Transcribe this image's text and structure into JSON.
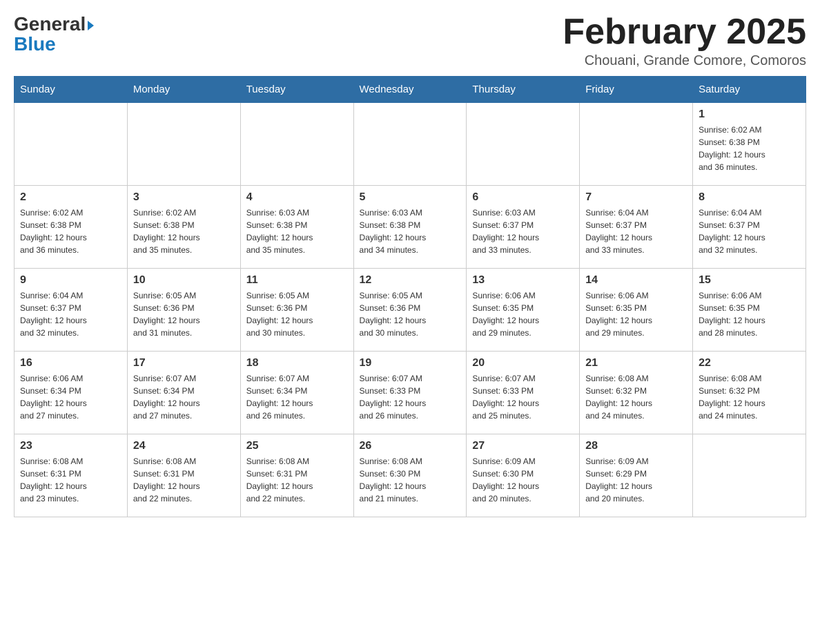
{
  "header": {
    "logo_line1": "General",
    "logo_line2": "Blue",
    "month_title": "February 2025",
    "location": "Chouani, Grande Comore, Comoros"
  },
  "days_of_week": [
    "Sunday",
    "Monday",
    "Tuesday",
    "Wednesday",
    "Thursday",
    "Friday",
    "Saturday"
  ],
  "weeks": [
    [
      {
        "day": "",
        "info": ""
      },
      {
        "day": "",
        "info": ""
      },
      {
        "day": "",
        "info": ""
      },
      {
        "day": "",
        "info": ""
      },
      {
        "day": "",
        "info": ""
      },
      {
        "day": "",
        "info": ""
      },
      {
        "day": "1",
        "info": "Sunrise: 6:02 AM\nSunset: 6:38 PM\nDaylight: 12 hours\nand 36 minutes."
      }
    ],
    [
      {
        "day": "2",
        "info": "Sunrise: 6:02 AM\nSunset: 6:38 PM\nDaylight: 12 hours\nand 36 minutes."
      },
      {
        "day": "3",
        "info": "Sunrise: 6:02 AM\nSunset: 6:38 PM\nDaylight: 12 hours\nand 35 minutes."
      },
      {
        "day": "4",
        "info": "Sunrise: 6:03 AM\nSunset: 6:38 PM\nDaylight: 12 hours\nand 35 minutes."
      },
      {
        "day": "5",
        "info": "Sunrise: 6:03 AM\nSunset: 6:38 PM\nDaylight: 12 hours\nand 34 minutes."
      },
      {
        "day": "6",
        "info": "Sunrise: 6:03 AM\nSunset: 6:37 PM\nDaylight: 12 hours\nand 33 minutes."
      },
      {
        "day": "7",
        "info": "Sunrise: 6:04 AM\nSunset: 6:37 PM\nDaylight: 12 hours\nand 33 minutes."
      },
      {
        "day": "8",
        "info": "Sunrise: 6:04 AM\nSunset: 6:37 PM\nDaylight: 12 hours\nand 32 minutes."
      }
    ],
    [
      {
        "day": "9",
        "info": "Sunrise: 6:04 AM\nSunset: 6:37 PM\nDaylight: 12 hours\nand 32 minutes."
      },
      {
        "day": "10",
        "info": "Sunrise: 6:05 AM\nSunset: 6:36 PM\nDaylight: 12 hours\nand 31 minutes."
      },
      {
        "day": "11",
        "info": "Sunrise: 6:05 AM\nSunset: 6:36 PM\nDaylight: 12 hours\nand 30 minutes."
      },
      {
        "day": "12",
        "info": "Sunrise: 6:05 AM\nSunset: 6:36 PM\nDaylight: 12 hours\nand 30 minutes."
      },
      {
        "day": "13",
        "info": "Sunrise: 6:06 AM\nSunset: 6:35 PM\nDaylight: 12 hours\nand 29 minutes."
      },
      {
        "day": "14",
        "info": "Sunrise: 6:06 AM\nSunset: 6:35 PM\nDaylight: 12 hours\nand 29 minutes."
      },
      {
        "day": "15",
        "info": "Sunrise: 6:06 AM\nSunset: 6:35 PM\nDaylight: 12 hours\nand 28 minutes."
      }
    ],
    [
      {
        "day": "16",
        "info": "Sunrise: 6:06 AM\nSunset: 6:34 PM\nDaylight: 12 hours\nand 27 minutes."
      },
      {
        "day": "17",
        "info": "Sunrise: 6:07 AM\nSunset: 6:34 PM\nDaylight: 12 hours\nand 27 minutes."
      },
      {
        "day": "18",
        "info": "Sunrise: 6:07 AM\nSunset: 6:34 PM\nDaylight: 12 hours\nand 26 minutes."
      },
      {
        "day": "19",
        "info": "Sunrise: 6:07 AM\nSunset: 6:33 PM\nDaylight: 12 hours\nand 26 minutes."
      },
      {
        "day": "20",
        "info": "Sunrise: 6:07 AM\nSunset: 6:33 PM\nDaylight: 12 hours\nand 25 minutes."
      },
      {
        "day": "21",
        "info": "Sunrise: 6:08 AM\nSunset: 6:32 PM\nDaylight: 12 hours\nand 24 minutes."
      },
      {
        "day": "22",
        "info": "Sunrise: 6:08 AM\nSunset: 6:32 PM\nDaylight: 12 hours\nand 24 minutes."
      }
    ],
    [
      {
        "day": "23",
        "info": "Sunrise: 6:08 AM\nSunset: 6:31 PM\nDaylight: 12 hours\nand 23 minutes."
      },
      {
        "day": "24",
        "info": "Sunrise: 6:08 AM\nSunset: 6:31 PM\nDaylight: 12 hours\nand 22 minutes."
      },
      {
        "day": "25",
        "info": "Sunrise: 6:08 AM\nSunset: 6:31 PM\nDaylight: 12 hours\nand 22 minutes."
      },
      {
        "day": "26",
        "info": "Sunrise: 6:08 AM\nSunset: 6:30 PM\nDaylight: 12 hours\nand 21 minutes."
      },
      {
        "day": "27",
        "info": "Sunrise: 6:09 AM\nSunset: 6:30 PM\nDaylight: 12 hours\nand 20 minutes."
      },
      {
        "day": "28",
        "info": "Sunrise: 6:09 AM\nSunset: 6:29 PM\nDaylight: 12 hours\nand 20 minutes."
      },
      {
        "day": "",
        "info": ""
      }
    ]
  ]
}
